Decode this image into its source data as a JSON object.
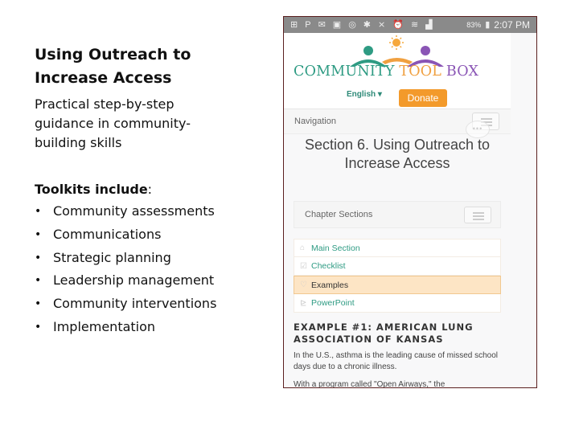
{
  "slide": {
    "title": "Using Outreach to Increase Access",
    "subtitle": "Practical step-by-step guidance in community-building skills",
    "toolkits_heading": "Toolkits include",
    "toolkits_colon": ":",
    "bullet": "•",
    "toolkits": [
      "Community assessments",
      "Communications",
      "Strategic planning",
      "Leadership management",
      "Community interventions",
      "Implementation"
    ]
  },
  "phone": {
    "statusbar": {
      "icons": [
        "add-icon",
        "paypal-icon",
        "mail-icon",
        "image-icon",
        "sync-icon",
        "bluetooth-icon",
        "mute-icon",
        "alarm-icon",
        "wifi-icon",
        "signal-icon"
      ],
      "battery": "83%",
      "time": "2:07 PM"
    },
    "logo": {
      "word1": "COMMUNITY",
      "word2": "TOOL",
      "word3": "BOX",
      "colors": {
        "green": "#2e9b83",
        "orange": "#f0a040",
        "purple": "#8a55b5"
      }
    },
    "language": "English",
    "donate_label": "Donate",
    "donate_color": "#f39a2b",
    "navigation_label": "Navigation",
    "section_title": "Section 6. Using Outreach to Increase Access",
    "chapter_sections_label": "Chapter Sections",
    "chapter_items": [
      {
        "label": "Main Section",
        "icon": "home-icon",
        "active": false
      },
      {
        "label": "Checklist",
        "icon": "checklist-icon",
        "active": false
      },
      {
        "label": "Examples",
        "icon": "lightbulb-icon",
        "active": true
      },
      {
        "label": "PowerPoint",
        "icon": "powerpoint-icon",
        "active": false
      }
    ],
    "example_heading": "EXAMPLE #1: AMERICAN LUNG ASSOCIATION OF KANSAS",
    "example_p1": "In the U.S., asthma is the leading cause of missed school days due to a chronic illness.",
    "example_p2": "With a program called \"Open Airways,\" the"
  }
}
